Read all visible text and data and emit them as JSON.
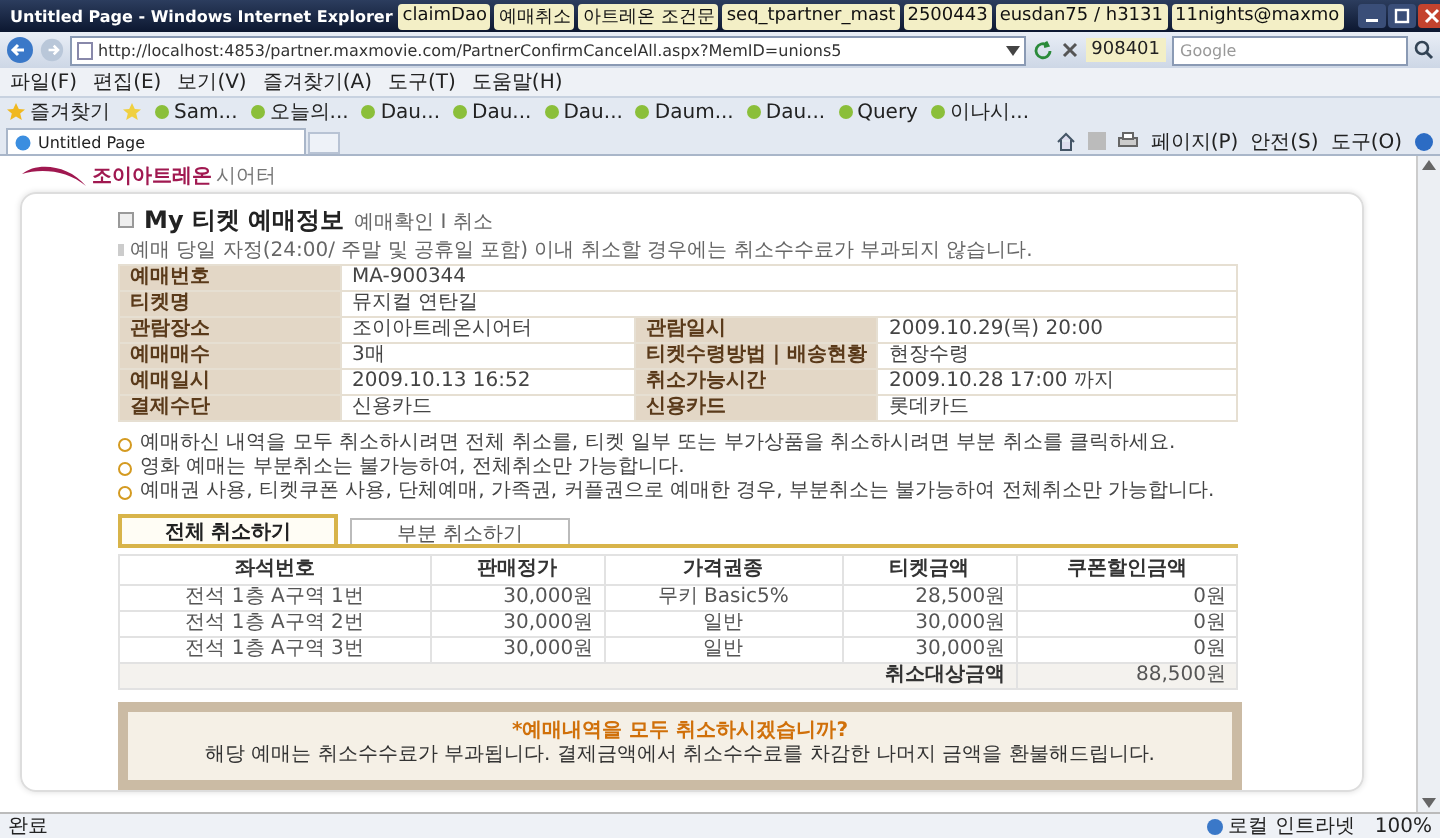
{
  "window": {
    "title": "Untitled Page - Windows Internet Explorer",
    "taskbar_items": [
      {
        "label": "claimDao"
      },
      {
        "label": "예매취소"
      },
      {
        "label": "아트레온 조건문"
      },
      {
        "label": "seq_tpartner_mast"
      },
      {
        "label": "2500443"
      },
      {
        "label": "eusdan75 / h3131"
      },
      {
        "label": "11nights@maxmo"
      }
    ]
  },
  "address_bar": {
    "url": "http://localhost:4853/partner.maxmovie.com/PartnerConfirmCancelAll.aspx?MemID=unions5",
    "search_placeholder": "Google",
    "overlay_chip": "908401"
  },
  "menu": [
    "파일(F)",
    "편집(E)",
    "보기(V)",
    "즐겨찾기(A)",
    "도구(T)",
    "도움말(H)"
  ],
  "favorites_bar": {
    "label": "즐겨찾기",
    "items": [
      "Sam...",
      "오늘의...",
      "Dau...",
      "Dau...",
      "Dau...",
      "Daum...",
      "Dau...",
      "Query",
      "이나시..."
    ]
  },
  "tab": {
    "title": "Untitled Page"
  },
  "command_bar": [
    "페이지(P)",
    "안전(S)",
    "도구(O)"
  ],
  "page": {
    "logo": {
      "main": "조이아트레온",
      "sub": "시어터"
    },
    "title": "My 티켓 예매정보",
    "subtitle": "예매확인 I 취소",
    "notice": "예매 당일 자정(24:00/ 주말 및 공휴일 포함) 이내 취소할 경우에는 취소수수료가 부과되지 않습니다.",
    "info_rows": [
      {
        "cells": [
          {
            "label": "예매번호",
            "value": "MA-900344"
          }
        ]
      },
      {
        "cells": [
          {
            "label": "티켓명",
            "value": "뮤지컬 연탄길"
          }
        ]
      },
      {
        "cells": [
          {
            "label": "관람장소",
            "value": "조이아트레온시어터"
          },
          {
            "label": "관람일시",
            "value": "2009.10.29(목) 20:00"
          }
        ]
      },
      {
        "cells": [
          {
            "label": "예매매수",
            "value": "3매"
          },
          {
            "label": "티켓수령방법 | 배송현황",
            "value": "현장수령"
          }
        ]
      },
      {
        "cells": [
          {
            "label": "예매일시",
            "value": "2009.10.13 16:52"
          },
          {
            "label": "취소가능시간",
            "value": "2009.10.28 17:00 까지"
          }
        ]
      },
      {
        "cells": [
          {
            "label": "결제수단",
            "value": "신용카드"
          },
          {
            "label": "신용카드",
            "value": "롯데카드"
          }
        ]
      }
    ],
    "bullets": [
      "예매하신 내역을 모두 취소하시려면 전체 취소를, 티켓 일부 또는 부가상품을 취소하시려면 부분 취소를 클릭하세요.",
      "영화 예매는 부분취소는 불가능하여, 전체취소만 가능합니다.",
      "예매권 사용, 티켓쿠폰 사용, 단체예매, 가족권, 커플권으로 예매한 경우, 부분취소는 불가능하여 전체취소만 가능합니다."
    ],
    "tabs": [
      {
        "label": "전체 취소하기",
        "selected": true
      },
      {
        "label": "부분 취소하기",
        "selected": false
      }
    ],
    "seat_table": {
      "columns": [
        "좌석번호",
        "판매정가",
        "가격권종",
        "티켓금액",
        "쿠폰할인금액"
      ],
      "rows": [
        [
          "전석 1층 A구역 1번",
          "30,000원",
          "무키 Basic5%",
          "28,500원",
          "0원"
        ],
        [
          "전석 1층 A구역 2번",
          "30,000원",
          "일반",
          "30,000원",
          "0원"
        ],
        [
          "전석 1층 A구역 3번",
          "30,000원",
          "일반",
          "30,000원",
          "0원"
        ]
      ],
      "total_label": "취소대상금액",
      "total_value": "88,500원"
    },
    "confirm": {
      "question": "*예매내역을 모두 취소하시겠습니까?",
      "message": "해당 예매는 취소수수료가 부과됩니다. 결제금액에서 취소수수료를 차감한 나머지 금액을 환불해드립니다."
    }
  },
  "status_bar": {
    "text": "완료",
    "zone": "로컬 인트라넷",
    "zoom": "100%"
  }
}
